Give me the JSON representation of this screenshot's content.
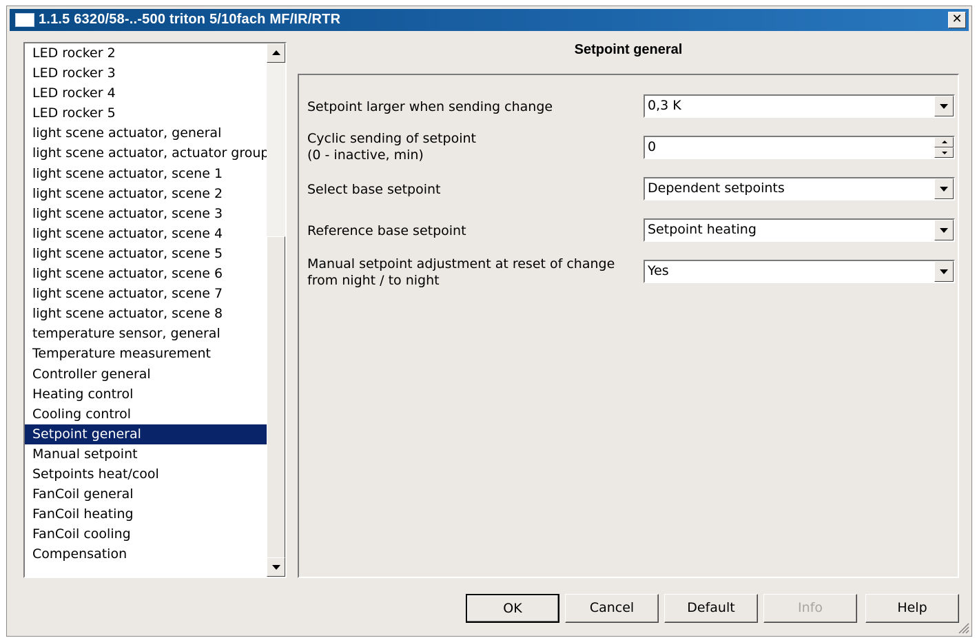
{
  "window": {
    "title": "1.1.5 6320/58-..-500 triton 5/10fach MF/IR/RTR",
    "close_label": "✕"
  },
  "sidebar": {
    "items": [
      {
        "label": "LED rocker 2"
      },
      {
        "label": "LED rocker 3"
      },
      {
        "label": "LED rocker 4"
      },
      {
        "label": "LED rocker 5"
      },
      {
        "label": "light scene actuator, general"
      },
      {
        "label": "light scene actuator, actuator groups"
      },
      {
        "label": "light scene actuator, scene 1"
      },
      {
        "label": "light scene actuator, scene 2"
      },
      {
        "label": "light scene actuator, scene 3"
      },
      {
        "label": "light scene actuator, scene 4"
      },
      {
        "label": "light scene actuator, scene 5"
      },
      {
        "label": "light scene actuator, scene 6"
      },
      {
        "label": "light scene actuator, scene 7"
      },
      {
        "label": "light scene actuator, scene 8"
      },
      {
        "label": "temperature sensor, general"
      },
      {
        "label": "Temperature measurement"
      },
      {
        "label": "Controller general"
      },
      {
        "label": "Heating control"
      },
      {
        "label": "Cooling control"
      },
      {
        "label": "Setpoint general",
        "selected": true
      },
      {
        "label": "Manual setpoint"
      },
      {
        "label": "Setpoints heat/cool"
      },
      {
        "label": "FanCoil general"
      },
      {
        "label": "FanCoil heating"
      },
      {
        "label": "FanCoil cooling"
      },
      {
        "label": "Compensation"
      }
    ]
  },
  "main": {
    "title": "Setpoint general",
    "params": [
      {
        "label1": "Setpoint larger when sending change",
        "label2": "",
        "type": "combo",
        "value": "0,3 K"
      },
      {
        "label1": "Cyclic sending of setpoint",
        "label2": "(0 - inactive, min)",
        "type": "spin",
        "value": "0"
      },
      {
        "label1": "Select base setpoint",
        "label2": "",
        "type": "combo",
        "value": "Dependent setpoints"
      },
      {
        "label1": "Reference base setpoint",
        "label2": "",
        "type": "combo",
        "value": "Setpoint heating"
      },
      {
        "label1": "Manual setpoint adjustment at reset of change",
        "label2": "from night / to night",
        "type": "combo",
        "value": "Yes"
      }
    ]
  },
  "buttons": {
    "ok": "OK",
    "cancel": "Cancel",
    "default": "Default",
    "info": "Info",
    "help": "Help"
  },
  "colors": {
    "selection": "#0a246a",
    "title_bar": "#0a4f8a",
    "dialog_bg": "#ece9e4"
  }
}
